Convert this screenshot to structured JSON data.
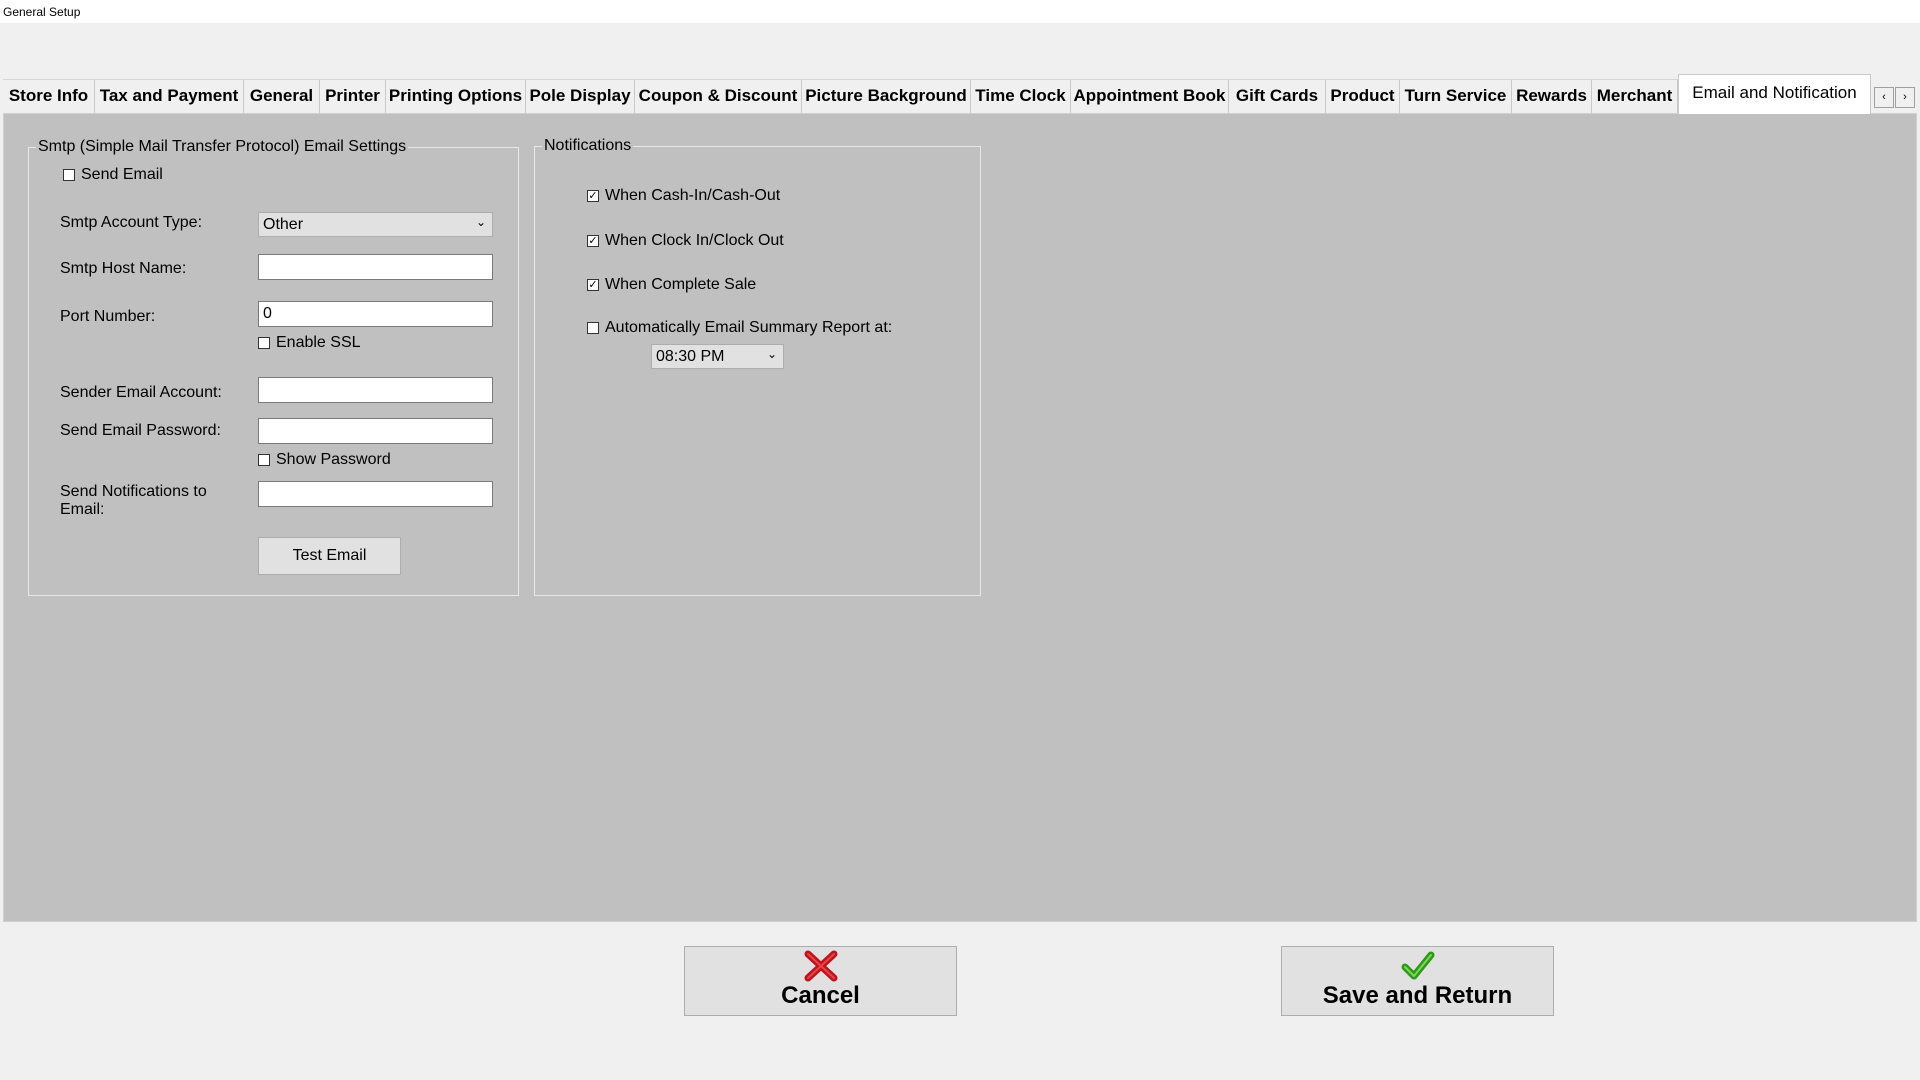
{
  "window": {
    "title": "General Setup"
  },
  "tabs": [
    "Store Info",
    "Tax and Payment",
    "General",
    "Printer",
    "Printing Options",
    "Pole Display",
    "Coupon & Discount",
    "Picture Background",
    "Time Clock",
    "Appointment Book",
    "Gift Cards",
    "Product",
    "Turn Service",
    "Rewards",
    "Merchant",
    "Email and Notification"
  ],
  "tab_scroll": {
    "left": "‹",
    "right": "›"
  },
  "smtp": {
    "group_title": "Smtp (Simple Mail Transfer Protocol) Email Settings",
    "send_email": {
      "label": "Send Email",
      "checked": false
    },
    "account_type": {
      "label": "Smtp Account Type:",
      "value": "Other"
    },
    "host_name": {
      "label": "Smtp Host Name:",
      "value": ""
    },
    "port": {
      "label": "Port Number:",
      "value": "0"
    },
    "enable_ssl": {
      "label": "Enable SSL",
      "checked": false
    },
    "sender_account": {
      "label": "Sender Email Account:",
      "value": ""
    },
    "password": {
      "label": "Send Email Password:",
      "value": ""
    },
    "show_password": {
      "label": "Show Password",
      "checked": false
    },
    "notify_to": {
      "label": "Send Notifications to Email:",
      "value": ""
    },
    "test_button": "Test Email"
  },
  "notifications": {
    "group_title": "Notifications",
    "cash_in_out": {
      "label": "When Cash-In/Cash-Out",
      "checked": true
    },
    "clock_in_out": {
      "label": "When Clock In/Clock Out",
      "checked": true
    },
    "complete_sale": {
      "label": "When Complete Sale",
      "checked": true
    },
    "auto_summary": {
      "label": "Automatically Email Summary Report at:",
      "checked": false
    },
    "summary_time": "08:30 PM"
  },
  "footer": {
    "cancel": "Cancel",
    "save": "Save and Return"
  },
  "colors": {
    "panel": "#c0c0c0",
    "cancel_icon": "#c0141c",
    "save_icon": "#3cb01e"
  }
}
